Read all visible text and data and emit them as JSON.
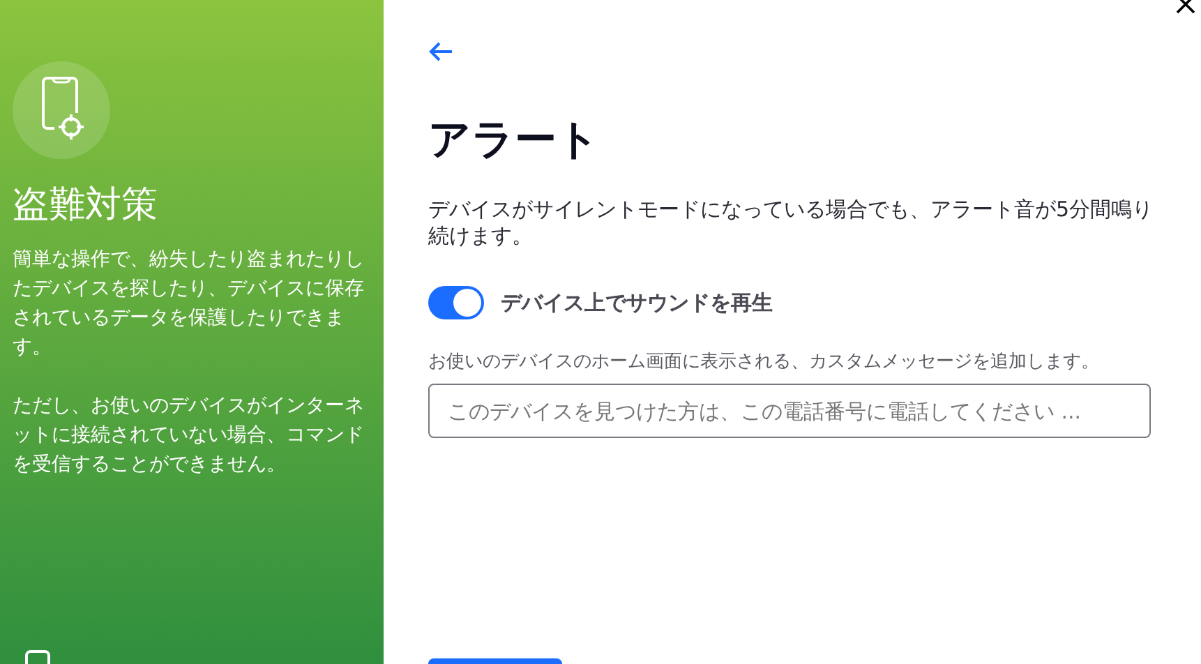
{
  "sidebar": {
    "title": "盗難対策",
    "paragraphs": [
      "簡単な操作で、紛失したり盗まれたりしたデバイスを探したり、デバイスに保存されているデータを保護したりできます。",
      "ただし、お使いのデバイスがインターネットに接続されていない場合、コマンドを受信することができません。"
    ]
  },
  "main": {
    "title": "アラート",
    "description": "デバイスがサイレントモードになっている場合でも、アラート音が5分間鳴り続けます。",
    "toggle": {
      "label": "デバイス上でサウンドを再生",
      "on": true
    },
    "message_hint": "お使いのデバイスのホーム画面に表示される、カスタムメッセージを追加します。",
    "message_field": {
      "placeholder": "このデバイスを見つけた方は、この電話番号に電話してください ..."
    }
  }
}
